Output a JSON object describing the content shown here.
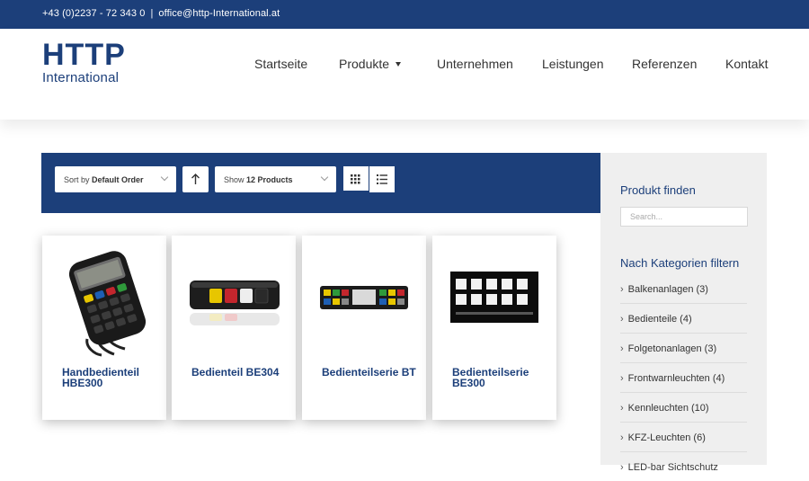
{
  "topbar": {
    "phone": "+43 (0)2237 - 72 343 0",
    "separator": "|",
    "email": "office@http-International.at"
  },
  "logo": {
    "line1": "HTTP",
    "line2": "International"
  },
  "nav": {
    "items": [
      {
        "label": "Startseite"
      },
      {
        "label": "Produkte"
      },
      {
        "label": "Unternehmen"
      },
      {
        "label": "Leistungen"
      },
      {
        "label": "Referenzen"
      },
      {
        "label": "Kontakt"
      }
    ]
  },
  "toolbar": {
    "sort_prefix": "Sort by",
    "sort_value": "Default Order",
    "show_prefix": "Show",
    "show_value": "12 Products"
  },
  "products": [
    {
      "title": "Handbedienteil HBE300"
    },
    {
      "title": "Bedienteil BE304"
    },
    {
      "title": "Bedienteilserie BT"
    },
    {
      "title": "Bedienteilserie BE300"
    }
  ],
  "sidebar": {
    "find_heading": "Produkt finden",
    "search_placeholder": "Search...",
    "filter_heading": "Nach Kategorien filtern",
    "categories": [
      {
        "label": "Balkenanlagen (3)"
      },
      {
        "label": "Bedienteile (4)"
      },
      {
        "label": "Folgetonanlagen (3)"
      },
      {
        "label": "Frontwarnleuchten (4)"
      },
      {
        "label": "Kennleuchten (10)"
      },
      {
        "label": "KFZ-Leuchten (6)"
      },
      {
        "label": "LED-bar Sichtschutz"
      }
    ]
  },
  "colors": {
    "brand": "#1c3f7a",
    "sidebar_bg": "#efefef"
  }
}
